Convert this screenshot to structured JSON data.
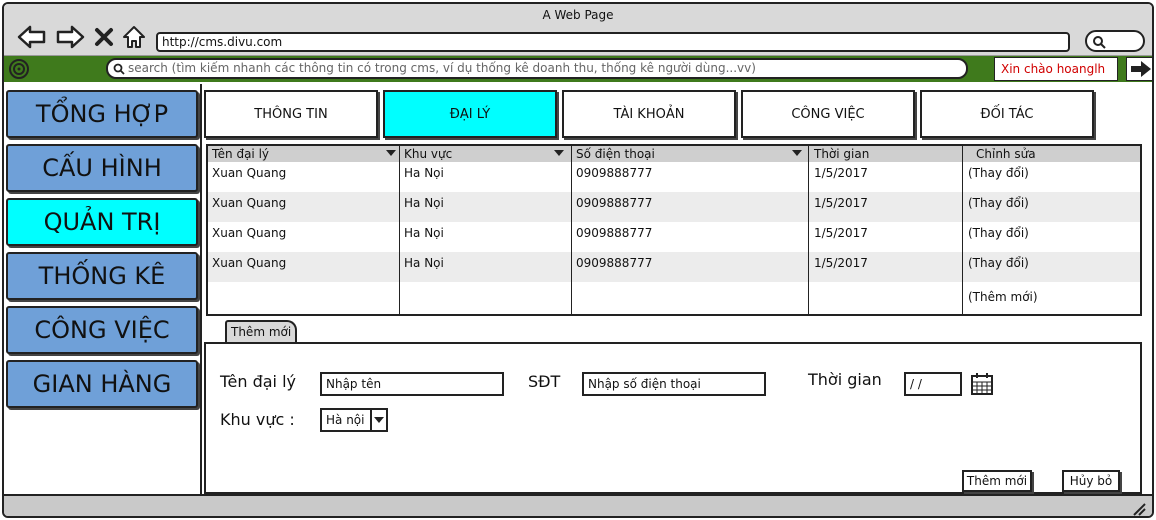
{
  "window": {
    "title": "A Web Page"
  },
  "browser": {
    "url": "http://cms.divu.com",
    "nav_icons": [
      "back-arrow-icon",
      "forward-arrow-icon",
      "close-x-icon",
      "home-icon"
    ]
  },
  "toolbar": {
    "search_placeholder": "search (tìm kiếm nhanh các thông tin có trong cms, ví dụ thống kê doanh thu, thống kê người dùng...vv)",
    "greeting": "Xin chào hoanglh",
    "greeting_color": "#d00000",
    "bar_color": "#3f7a1c"
  },
  "sidebar": {
    "items": [
      {
        "label": "TỔNG HỢP"
      },
      {
        "label": "CẤU HÌNH"
      },
      {
        "label": "QUẢN TRỊ"
      },
      {
        "label": "THỐNG KÊ"
      },
      {
        "label": "CÔNG VIỆC"
      },
      {
        "label": "GIAN HÀNG"
      }
    ],
    "active_item": "QUẢN TRỊ",
    "item_color": "#6fa0d8",
    "active_color": "#00ffff"
  },
  "tabs": {
    "items": [
      {
        "label": "THÔNG TIN"
      },
      {
        "label": "ĐẠI LÝ"
      },
      {
        "label": "TÀI KHOẢN"
      },
      {
        "label": "CÔNG VIỆC"
      },
      {
        "label": "ĐỐI TÁC"
      }
    ],
    "active_tab": "ĐẠI LÝ"
  },
  "table": {
    "columns": [
      {
        "label": "Tên đại lý"
      },
      {
        "label": "Khu vực"
      },
      {
        "label": "Số điện thoại"
      },
      {
        "label": "Thời gian"
      },
      {
        "label": "Chỉnh sửa"
      }
    ],
    "rows": [
      {
        "name": "Xuan Quang",
        "region": "Ha Nọi",
        "phone": "0909888777",
        "time": "1/5/2017",
        "action": "(Thay đổi)"
      },
      {
        "name": "Xuan Quang",
        "region": "Ha Nọi",
        "phone": "0909888777",
        "time": "1/5/2017",
        "action": "(Thay đổi)"
      },
      {
        "name": "Xuan Quang",
        "region": "Ha Nọi",
        "phone": "0909888777",
        "time": "1/5/2017",
        "action": "(Thay đổi)"
      },
      {
        "name": "Xuan Quang",
        "region": "Ha Nọi",
        "phone": "0909888777",
        "time": "1/5/2017",
        "action": "(Thay đổi)"
      }
    ],
    "add_row_action": "(Thêm mới)"
  },
  "form": {
    "tab_label": "Thêm mới",
    "name_label": "Tên đại lý",
    "name_placeholder": "Nhập tên",
    "phone_label": "SĐT",
    "phone_placeholder": "Nhập số điện thoại",
    "time_label": "Thời gian",
    "time_value": "/ /",
    "region_label": "Khu vực :",
    "region_value": "Hà nội",
    "add_button": "Thêm mới",
    "cancel_button": "Hủy bỏ"
  }
}
